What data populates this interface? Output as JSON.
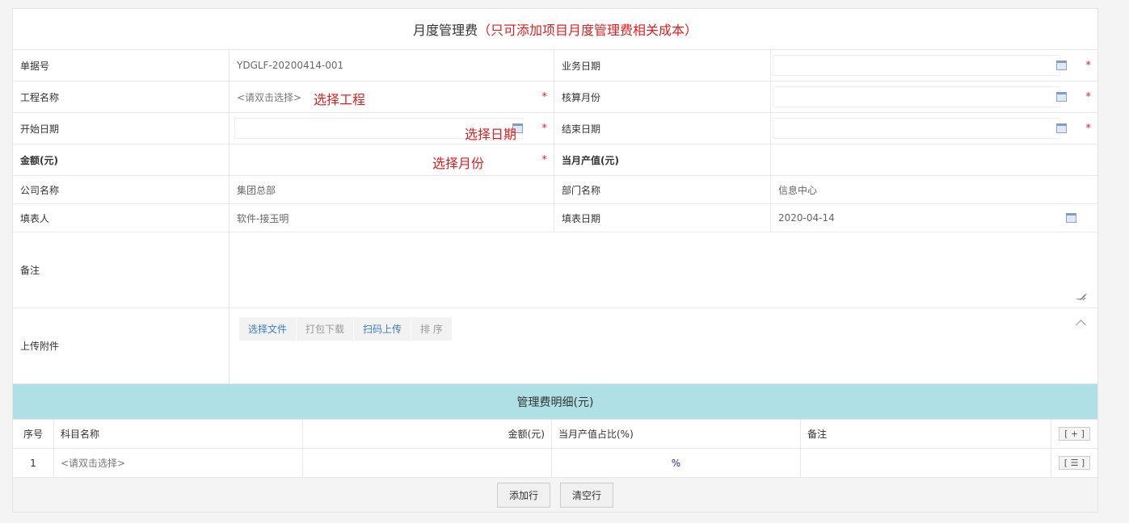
{
  "header": {
    "title": "月度管理费",
    "note": "（只可添加项目月度管理费相关成本）"
  },
  "fields": {
    "doc_no_label": "单据号",
    "doc_no": "YDGLF-20200414-001",
    "biz_date_label": "业务日期",
    "project_label": "工程名称",
    "project_hint": "<请双击选择>",
    "project_annotation": "选择工程",
    "acct_month_label": "核算月份",
    "start_label": "开始日期",
    "start_annotation": "选择日期",
    "end_label": "结束日期",
    "amount_label": "金额(元)",
    "amount_annotation": "选择月份",
    "output_label": "当月产值(元)",
    "company_label": "公司名称",
    "company": "集团总部",
    "dept_label": "部门名称",
    "dept": "信息中心",
    "filler_label": "填表人",
    "filler": "软件-接玉明",
    "fill_date_label": "填表日期",
    "fill_date": "2020-04-14",
    "remark_label": "备注",
    "upload_label": "上传附件",
    "required": "*"
  },
  "upload_buttons": [
    "选择文件",
    "打包下载",
    "扫码上传",
    "排 序"
  ],
  "detail": {
    "title": "管理费明细(元)",
    "columns": [
      "序号",
      "科目名称",
      "金额(元)",
      "当月产值占比(%)",
      "备注"
    ],
    "add_icon": "[ + ]",
    "rows": [
      {
        "no": "1",
        "subject": "<请双击选择>",
        "pct": "%",
        "menu": "[ ☰ ]"
      }
    ]
  },
  "footer": {
    "add_row": "添加行",
    "clear_rows": "清空行"
  }
}
